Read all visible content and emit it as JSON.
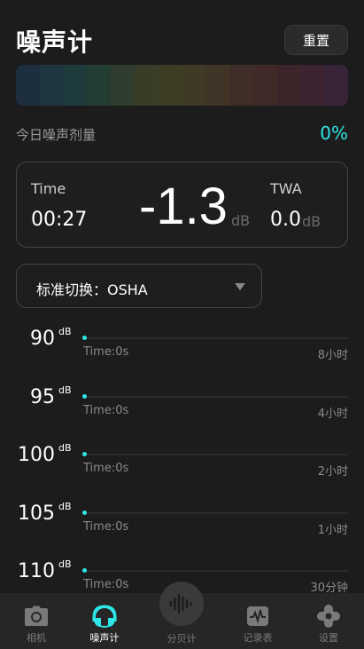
{
  "header": {
    "title": "噪声计",
    "reset_label": "重置"
  },
  "color_bar": {
    "segments": [
      "#1d2f3f",
      "#1f3540",
      "#203b3e",
      "#243d33",
      "#2e3d2d",
      "#383d28",
      "#3d3d26",
      "#3f3a26",
      "#3f3426",
      "#3f2e27",
      "#3f2a28",
      "#3d2629",
      "#3b2430",
      "#382438"
    ]
  },
  "dose": {
    "label": "今日噪声剂量",
    "value": "0%"
  },
  "meter": {
    "time_label": "Time",
    "time_value": "00:27",
    "current_value": "-1.3",
    "current_unit": "dB",
    "twa_label": "TWA",
    "twa_value": "0.0",
    "twa_unit": "dB"
  },
  "standard": {
    "label": "标准切换：OSHA"
  },
  "levels": [
    {
      "db": "90",
      "unit": "dB",
      "time": "Time:0s",
      "limit": "8小时"
    },
    {
      "db": "95",
      "unit": "dB",
      "time": "Time:0s",
      "limit": "4小时"
    },
    {
      "db": "100",
      "unit": "dB",
      "time": "Time:0s",
      "limit": "2小时"
    },
    {
      "db": "105",
      "unit": "dB",
      "time": "Time:0s",
      "limit": "1小时"
    },
    {
      "db": "110",
      "unit": "dB",
      "time": "Time:0s",
      "limit": "30分钟"
    }
  ],
  "nav": {
    "camera": {
      "label": "相机",
      "icon": "camera-icon"
    },
    "noise": {
      "label": "噪声计",
      "icon": "headphones-icon"
    },
    "decibel": {
      "label": "分贝计",
      "icon": "waveform-icon"
    },
    "records": {
      "label": "记录表",
      "icon": "pulse-chart-icon"
    },
    "settings": {
      "label": "设置",
      "icon": "gear-icon"
    }
  },
  "colors": {
    "accent": "#2ee6e6",
    "background": "#1c1c1c",
    "nav_bg": "#262626"
  }
}
